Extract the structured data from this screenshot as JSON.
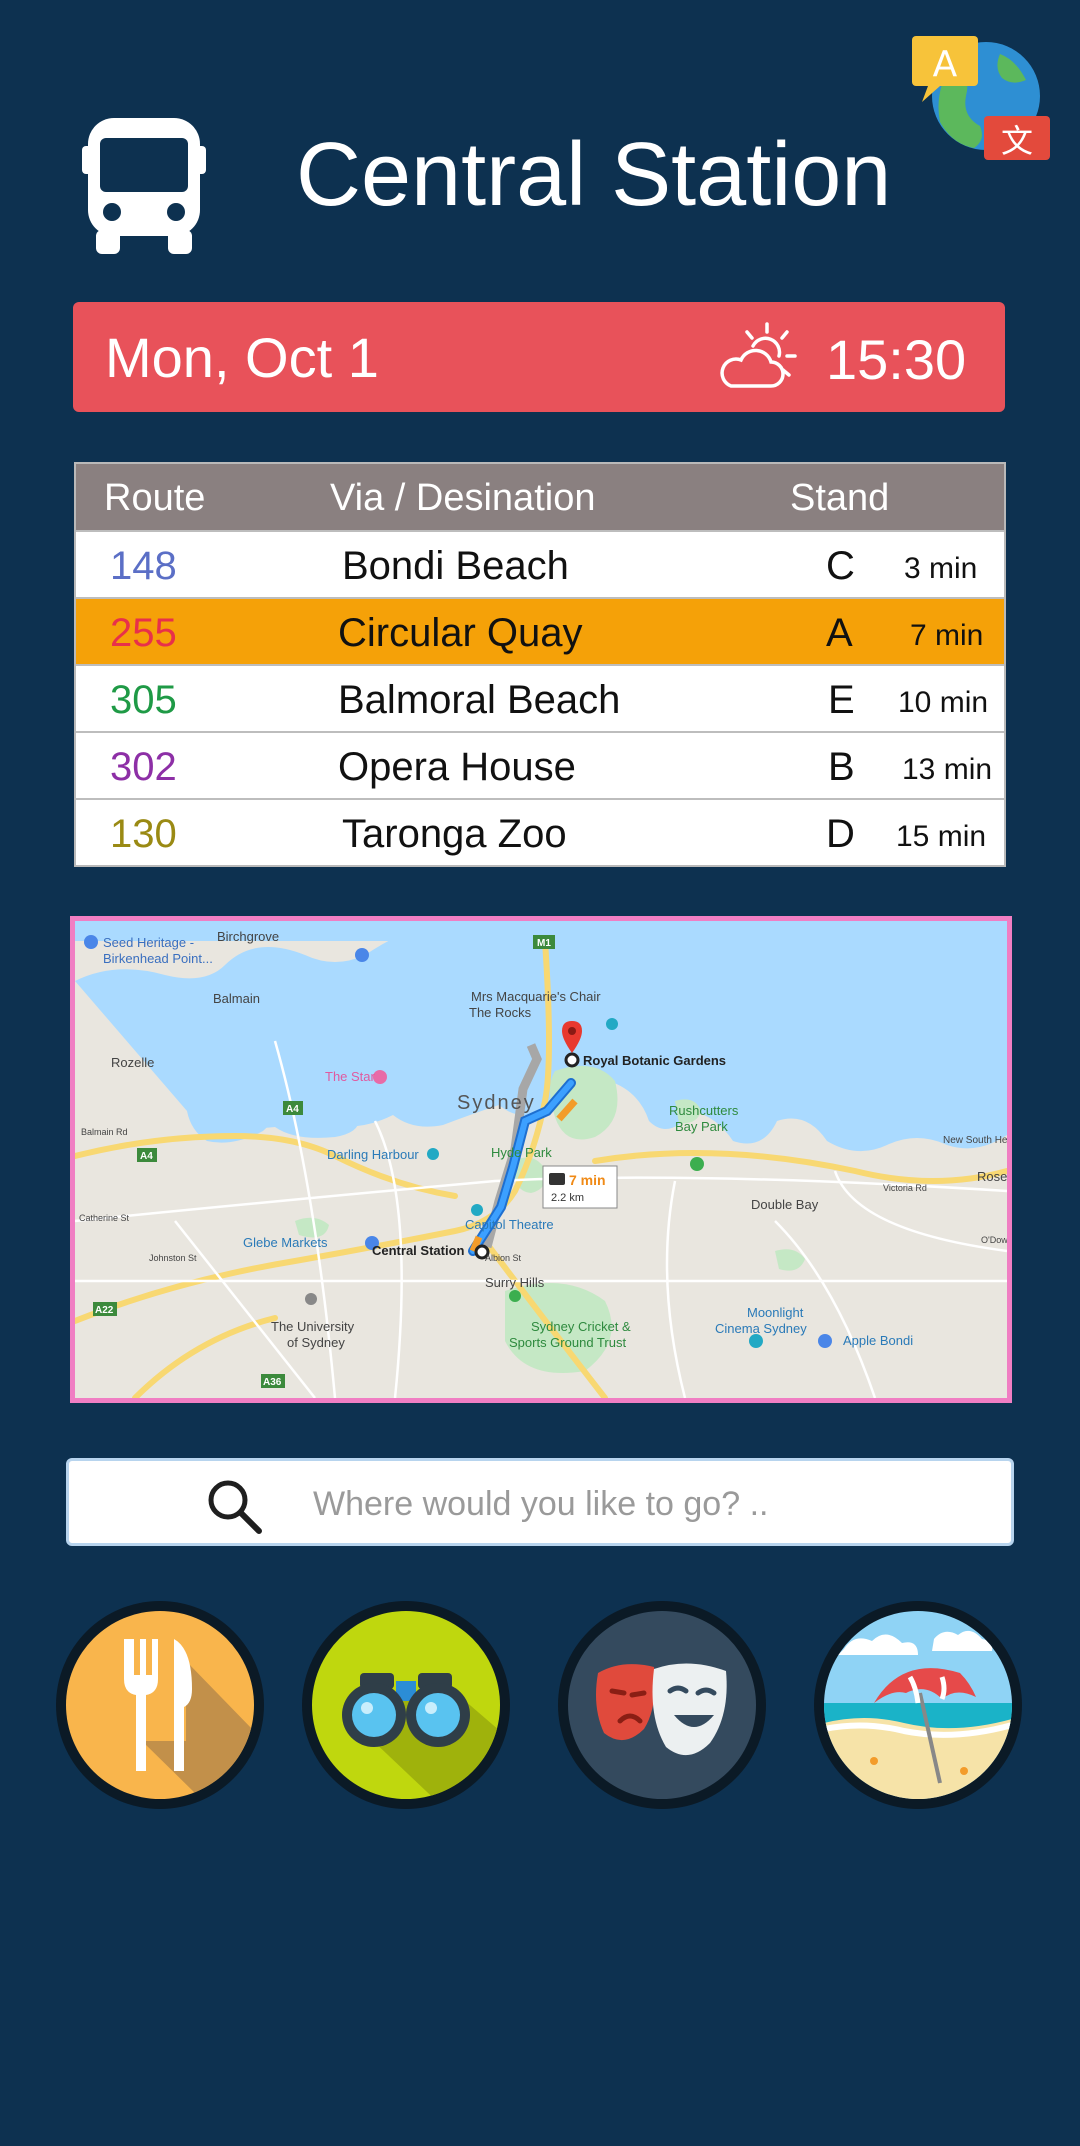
{
  "header": {
    "title": "Central Station",
    "icons": {
      "bus": "bus-icon",
      "language": "translate-globe-icon"
    }
  },
  "date_bar": {
    "date": "Mon, Oct 1",
    "weather_icon": "partly-cloudy-icon",
    "time": "15:30",
    "color": "#e8525a"
  },
  "departures": {
    "headers": {
      "route": "Route",
      "destination": "Via / Desination",
      "stand": "Stand"
    },
    "rows": [
      {
        "route": "148",
        "destination": "Bondi Beach",
        "stand": "C",
        "minutes": "3 min",
        "route_color": "#5b6fc6"
      },
      {
        "route": "255",
        "destination": "Circular Quay",
        "stand": "A",
        "minutes": "7 min",
        "route_color": "#e8304a"
      },
      {
        "route": "305",
        "destination": "Balmoral Beach",
        "stand": "E",
        "minutes": "10 min",
        "route_color": "#1f9a46"
      },
      {
        "route": "302",
        "destination": "Opera House",
        "stand": "B",
        "minutes": "13 min",
        "route_color": "#8d2fa6"
      },
      {
        "route": "130",
        "destination": "Taronga Zoo",
        "stand": "D",
        "minutes": "15 min",
        "route_color": "#9a8a14"
      }
    ],
    "highlight_color": "#f5a108"
  },
  "map": {
    "labels": {
      "seed": "Seed Heritage -",
      "seed2": "Birkenhead Point...",
      "birchgrove": "Birchgrove",
      "balmain": "Balmain",
      "rozelle": "Rozelle",
      "mrs": "Mrs Macquarie's Chair",
      "rocks": "The Rocks",
      "rbg": "Royal Botanic Gardens",
      "star": "The Star",
      "sydney": "Sydney",
      "rush": "Rushcutters",
      "rush2": "Bay Park",
      "darling": "Darling Harbour",
      "hyde": "Hyde Park",
      "duration": "7 min",
      "distance": "2.2 km",
      "capitol": "Capitol Theatre",
      "double_bay": "Double Bay",
      "glebe": "Glebe Markets",
      "central": "Central Station",
      "surry": "Surry Hills",
      "uni": "The University",
      "uni2": "of Sydney",
      "moonlight": "Moonlight",
      "moonlight2": "Cinema Sydney",
      "scg": "Sydney Cricket &",
      "scg2": "Sports Ground Trust",
      "apple": "Apple Bondi",
      "rose": "Rose",
      "nsh": "New South Head",
      "m1": "M1",
      "a4": "A4",
      "a4b": "A4",
      "a22": "A22",
      "a36": "A36",
      "balmain_rd": "Balmain Rd",
      "catherine": "Catherine St",
      "johnston": "Johnston St",
      "victoria": "Victoria Rd",
      "odowd": "O'Dowd St",
      "albion": "Albion St"
    },
    "colors": {
      "water": "#aadaff",
      "land": "#e9e6df",
      "route": "#2a8cf0",
      "park": "#c5e8c5"
    }
  },
  "search": {
    "placeholder": "Where would you like to go? .."
  },
  "categories": [
    {
      "name": "food",
      "icon": "fork-knife-icon",
      "color": "#f9b54c"
    },
    {
      "name": "sightseeing",
      "icon": "binoculars-icon",
      "color": "#bfd70e"
    },
    {
      "name": "theatre",
      "icon": "theatre-masks-icon",
      "color": "#344a5e"
    },
    {
      "name": "beach",
      "icon": "beach-umbrella-icon",
      "color": "#8fd3f5"
    }
  ]
}
